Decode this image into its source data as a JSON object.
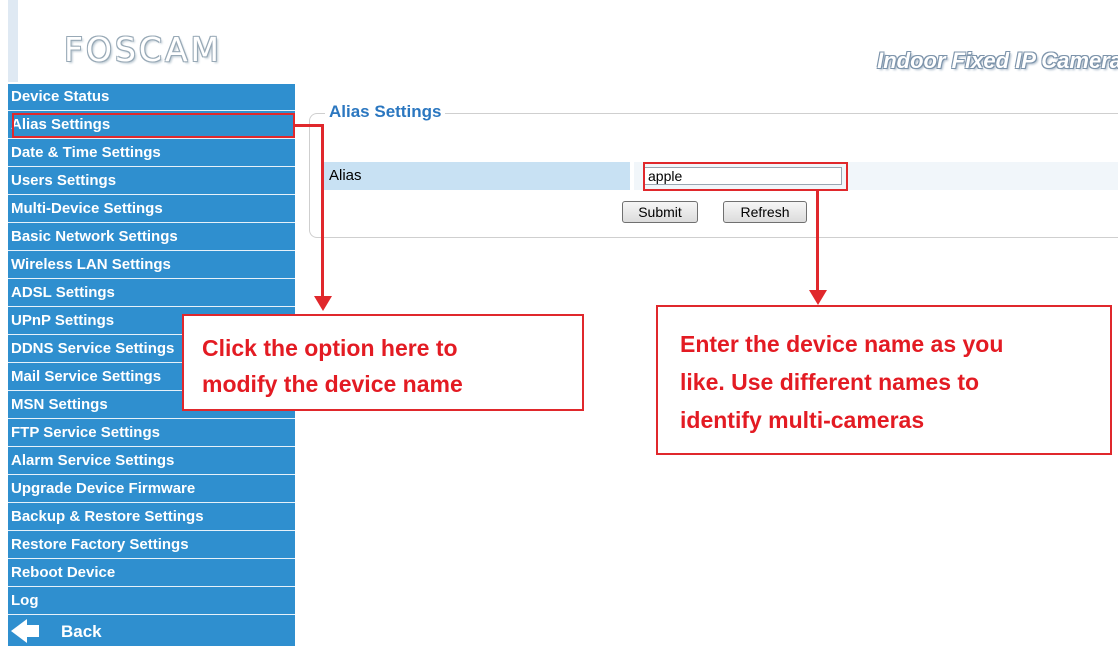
{
  "header": {
    "logo": "FOSCAM",
    "product_title": "Indoor Fixed IP Camera"
  },
  "sidebar": {
    "items": [
      {
        "label": "Device Status"
      },
      {
        "label": "Alias Settings"
      },
      {
        "label": "Date & Time Settings"
      },
      {
        "label": "Users Settings"
      },
      {
        "label": "Multi-Device Settings"
      },
      {
        "label": "Basic Network Settings"
      },
      {
        "label": "Wireless LAN Settings"
      },
      {
        "label": "ADSL Settings"
      },
      {
        "label": "UPnP Settings"
      },
      {
        "label": "DDNS Service Settings"
      },
      {
        "label": "Mail Service Settings"
      },
      {
        "label": "MSN Settings"
      },
      {
        "label": "FTP Service Settings"
      },
      {
        "label": "Alarm Service Settings"
      },
      {
        "label": "Upgrade Device Firmware"
      },
      {
        "label": "Backup & Restore Settings"
      },
      {
        "label": "Restore Factory Settings"
      },
      {
        "label": "Reboot Device"
      },
      {
        "label": "Log"
      }
    ],
    "back_label": "Back"
  },
  "main": {
    "section_title": "Alias Settings",
    "alias_label": "Alias",
    "alias_value": "apple",
    "submit_label": "Submit",
    "refresh_label": "Refresh"
  },
  "annotations": {
    "left_callout_line1": "Click the option here to",
    "left_callout_line2": "modify the device name",
    "right_callout_line1": "Enter the device name as you",
    "right_callout_line2": "like. Use different names to",
    "right_callout_line3": "identify multi-cameras"
  },
  "colors": {
    "sidebar_bg": "#2f8fcf",
    "annotation_red": "#e0282c",
    "title_blue": "#2b77c0"
  }
}
